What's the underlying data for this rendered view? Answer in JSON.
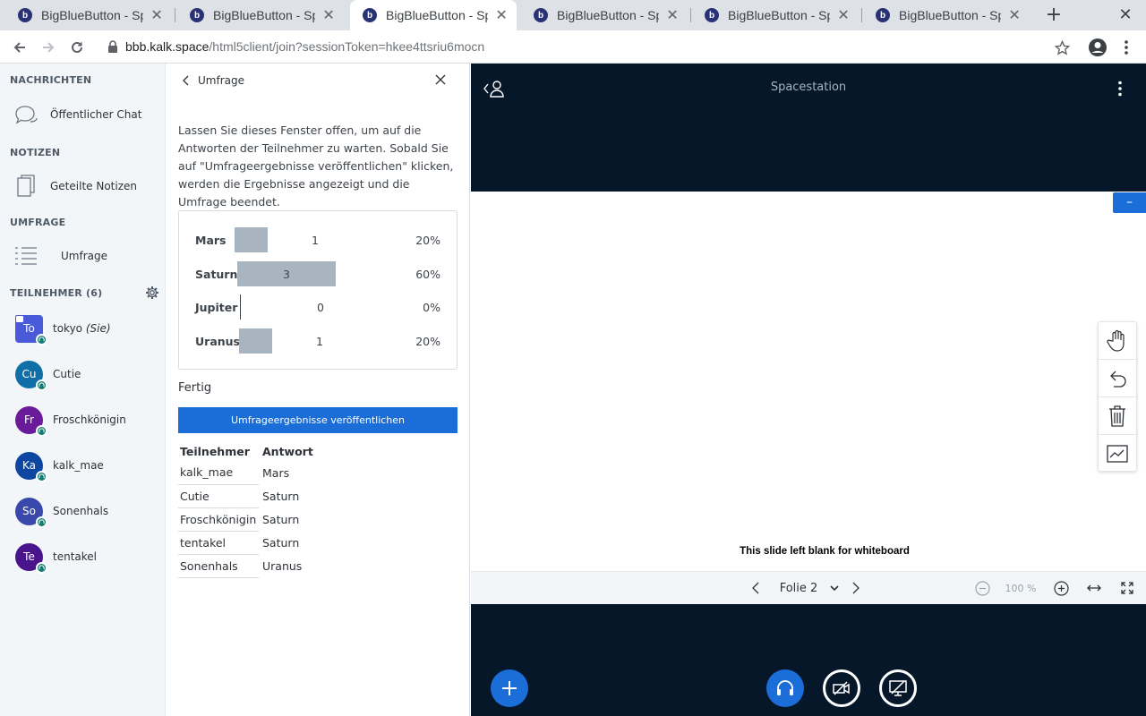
{
  "browser": {
    "tabs": [
      {
        "title": "BigBlueButton - Sp",
        "active": false
      },
      {
        "title": "BigBlueButton - Sp",
        "active": false
      },
      {
        "title": "BigBlueButton - Sp",
        "active": true
      },
      {
        "title": "BigBlueButton - Sp",
        "active": false
      },
      {
        "title": "BigBlueButton - Sp",
        "active": false
      },
      {
        "title": "BigBlueButton - Sp",
        "active": false
      }
    ],
    "url_host": "bbb.kalk.space",
    "url_path": "/html5client/join?sessionToken=hkee4ttsriu6mocn"
  },
  "sidebar": {
    "messages_title": "NACHRICHTEN",
    "public_chat": "Öffentlicher Chat",
    "notes_title": "NOTIZEN",
    "shared_notes": "Geteilte Notizen",
    "poll_title": "UMFRAGE",
    "poll_item": "Umfrage",
    "participants_title": "TEILNEHMER (6)",
    "users": [
      {
        "initials": "To",
        "name": "tokyo",
        "suffix": "(Sie)",
        "color": "#4a5bd9",
        "moderator": true
      },
      {
        "initials": "Cu",
        "name": "Cutie",
        "suffix": "",
        "color": "#0f6fa6",
        "moderator": false
      },
      {
        "initials": "Fr",
        "name": "Froschkönigin",
        "suffix": "",
        "color": "#6a1b9a",
        "moderator": false
      },
      {
        "initials": "Ka",
        "name": "kalk_mae",
        "suffix": "",
        "color": "#0d47a1",
        "moderator": false
      },
      {
        "initials": "So",
        "name": "Sonenhals",
        "suffix": "",
        "color": "#3949ab",
        "moderator": false
      },
      {
        "initials": "Te",
        "name": "tentakel",
        "suffix": "",
        "color": "#4a148c",
        "moderator": false
      }
    ]
  },
  "poll": {
    "back_label": "Umfrage",
    "description": "Lassen Sie dieses Fenster offen, um auf die Antworten der Teilnehmer zu warten. Sobald Sie auf \"Umfrageergebnisse veröffentlichen\" klicken, werden die Ergebnisse angezeigt und die Umfrage beendet.",
    "results": [
      {
        "label": "Mars",
        "count": 1,
        "percent": "20%",
        "fraction": 0.2
      },
      {
        "label": "Saturn",
        "count": 3,
        "percent": "60%",
        "fraction": 0.6
      },
      {
        "label": "Jupiter",
        "count": 0,
        "percent": "0%",
        "fraction": 0.0
      },
      {
        "label": "Uranus",
        "count": 1,
        "percent": "20%",
        "fraction": 0.2
      }
    ],
    "status": "Fertig",
    "publish_label": "Umfrageergebnisse veröffentlichen",
    "table_headers": {
      "participant": "Teilnehmer",
      "answer": "Antwort"
    },
    "responses": [
      {
        "name": "kalk_mae",
        "answer": "Mars"
      },
      {
        "name": "Cutie",
        "answer": "Saturn"
      },
      {
        "name": "Froschkönigin",
        "answer": "Saturn"
      },
      {
        "name": "tentakel",
        "answer": "Saturn"
      },
      {
        "name": "Sonenhals",
        "answer": "Uranus"
      }
    ]
  },
  "presentation": {
    "title": "Spacestation",
    "slide_text": "This slide left blank for whiteboard",
    "slide_label": "Folie 2",
    "zoom": "100 %"
  },
  "colors": {
    "accent": "#1b6ed7",
    "stage_bg": "#06172a",
    "bar": "#a8b5c0"
  }
}
